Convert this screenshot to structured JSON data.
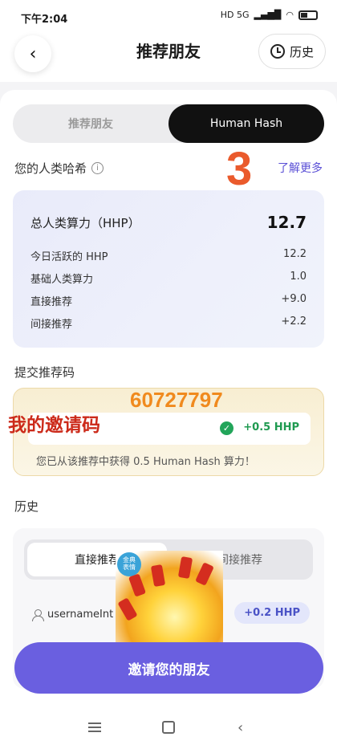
{
  "status_bar": {
    "time": "下午2:04",
    "icons_text": "HD 5G"
  },
  "header": {
    "title": "推荐朋友",
    "history_label": "历史"
  },
  "tabs": {
    "referral": "推荐朋友",
    "human_hash": "Human Hash"
  },
  "section": {
    "title": "您的人类哈希",
    "learn_more": "了解更多",
    "annotation_number": "3"
  },
  "stats": {
    "total_label": "总人类算力（HHP）",
    "total_value": "12.7",
    "rows": [
      {
        "label": "今日活跃的 HHP",
        "value": "12.2"
      },
      {
        "label": "基础人类算力",
        "value": "1.0"
      },
      {
        "label": "直接推荐",
        "value": "+9.0"
      },
      {
        "label": "间接推荐",
        "value": "+2.2"
      }
    ]
  },
  "referral": {
    "title": "提交推荐码",
    "code_overlay": "60727797",
    "my_code_overlay": "我的邀请码",
    "bonus": "+0.5 HHP",
    "note": "您已从该推荐中获得 0.5 Human Hash 算力！"
  },
  "history": {
    "title": "历史",
    "tab_direct": "直接推荐",
    "tab_indirect": "间接推荐",
    "user_name": "usernameInt",
    "user_bonus": "+0.2 HHP"
  },
  "sticker": {
    "badge_line1": "金典",
    "badge_line2": "表情"
  },
  "invite_button": "邀请您的朋友",
  "colors": {
    "accent": "#6a5fe0",
    "active_tab": "#111111",
    "green": "#22a55a",
    "orange_annotation": "#ea5a2c"
  }
}
